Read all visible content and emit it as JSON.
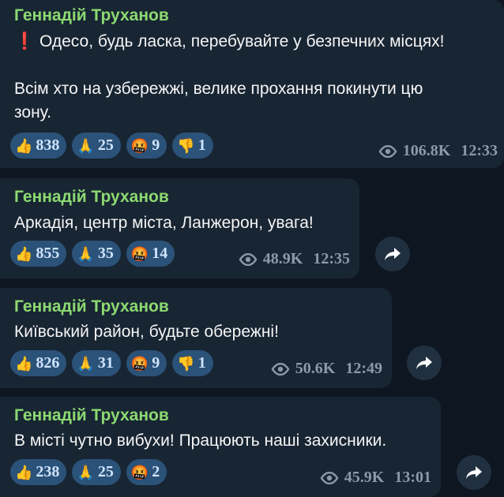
{
  "messages": [
    {
      "sender": "Геннадій Труханов",
      "alert_icon": "exclamation-icon",
      "lines": [
        "Одесо, будь ласка, перебувайте у безпечних місцях!",
        "",
        "Всім хто на узбережжі, велике прохання покинути цю",
        "зону."
      ],
      "reactions": [
        {
          "icon": "thumbs-up-icon",
          "emoji": "👍",
          "count": "838"
        },
        {
          "icon": "praying-hands-icon",
          "emoji": "🙏",
          "count": "25"
        },
        {
          "icon": "angry-face-icon",
          "emoji": "🤬",
          "count": "9"
        },
        {
          "icon": "thumbs-down-icon",
          "emoji": "👎",
          "count": "1"
        }
      ],
      "views": "106.8K",
      "time": "12:33"
    },
    {
      "sender": "Геннадій Труханов",
      "lines": [
        "Аркадія, центр міста, Ланжерон, увага!"
      ],
      "reactions": [
        {
          "icon": "thumbs-up-icon",
          "emoji": "👍",
          "count": "855"
        },
        {
          "icon": "praying-hands-icon",
          "emoji": "🙏",
          "count": "35"
        },
        {
          "icon": "angry-face-icon",
          "emoji": "🤬",
          "count": "14"
        }
      ],
      "views": "48.9K",
      "time": "12:35"
    },
    {
      "sender": "Геннадій Труханов",
      "lines": [
        "Київський район, будьте обережні!"
      ],
      "reactions": [
        {
          "icon": "thumbs-up-icon",
          "emoji": "👍",
          "count": "826"
        },
        {
          "icon": "praying-hands-icon",
          "emoji": "🙏",
          "count": "31"
        },
        {
          "icon": "angry-face-icon",
          "emoji": "🤬",
          "count": "9"
        },
        {
          "icon": "thumbs-down-icon",
          "emoji": "👎",
          "count": "1"
        }
      ],
      "views": "50.6K",
      "time": "12:49"
    },
    {
      "sender": "Геннадій Труханов",
      "lines": [
        "В місті чутно вибухи! Працюють наші захисники."
      ],
      "reactions": [
        {
          "icon": "thumbs-up-icon",
          "emoji": "👍",
          "count": "238"
        },
        {
          "icon": "praying-hands-icon",
          "emoji": "🙏",
          "count": "25"
        },
        {
          "icon": "angry-face-icon",
          "emoji": "🤬",
          "count": "2"
        }
      ],
      "views": "45.9K",
      "time": "13:01"
    }
  ],
  "colors": {
    "background": "#0e1621",
    "bubble": "#182533",
    "sender": "#8cd971",
    "reaction_pill": "#2b5278",
    "meta": "#8a9aab"
  }
}
